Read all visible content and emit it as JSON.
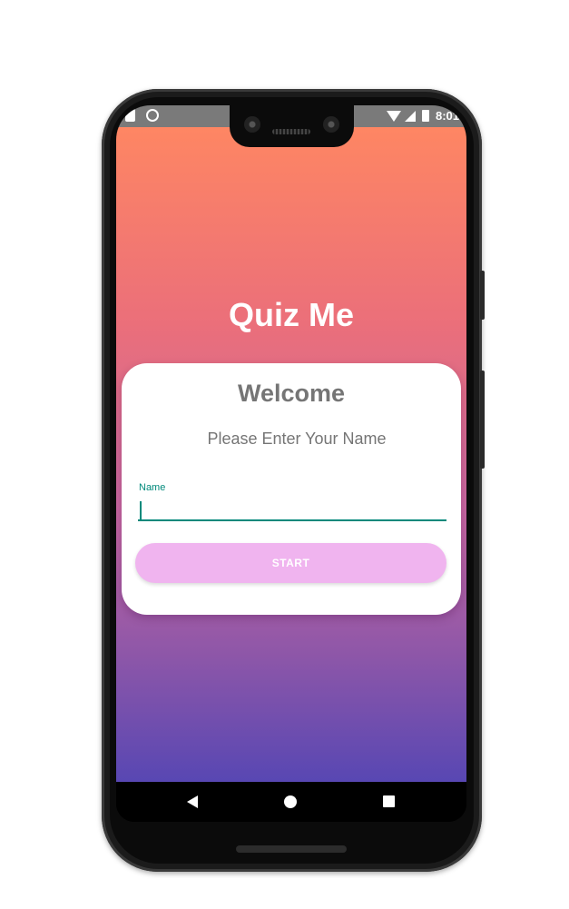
{
  "status_bar": {
    "time": "8:01",
    "icons": [
      "sd-card-icon",
      "circle-icon",
      "wifi-icon",
      "signal-icon",
      "battery-icon"
    ]
  },
  "app": {
    "title": "Quiz Me",
    "gradient_colors": [
      "#fe8663",
      "#eb6f7a",
      "#c766a0",
      "#8f57a8",
      "#5847b3"
    ]
  },
  "card": {
    "heading": "Welcome",
    "subtitle": "Please Enter Your Name",
    "name_field": {
      "label": "Name",
      "value": "",
      "accent_color": "#00897b"
    },
    "start_button": {
      "label": "START",
      "color": "#f0b4ef"
    }
  },
  "nav_bar": {
    "icons": [
      "back-icon",
      "home-icon",
      "recents-icon"
    ]
  }
}
